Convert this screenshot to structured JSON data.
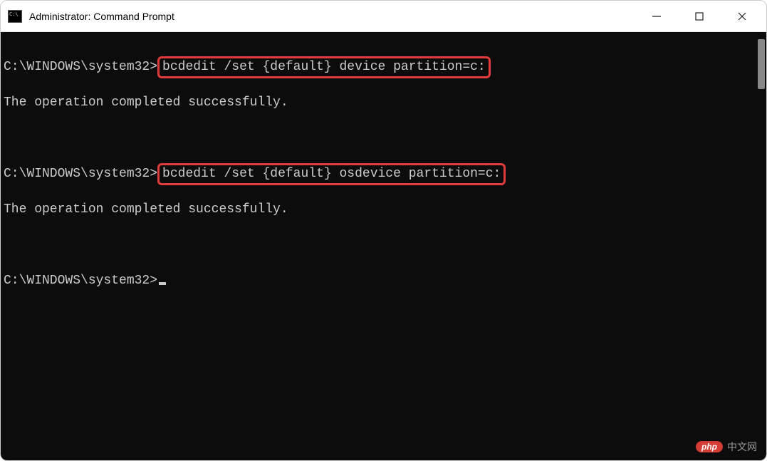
{
  "window": {
    "title": "Administrator: Command Prompt"
  },
  "console": {
    "prompt": "C:\\WINDOWS\\system32>",
    "commands": {
      "cmd1": "bcdedit /set {default} device partition=c:",
      "cmd2": "bcdedit /set {default} osdevice partition=c:"
    },
    "output": {
      "success": "The operation completed successfully."
    }
  },
  "watermark": {
    "badge": "php",
    "text": "中文网"
  }
}
